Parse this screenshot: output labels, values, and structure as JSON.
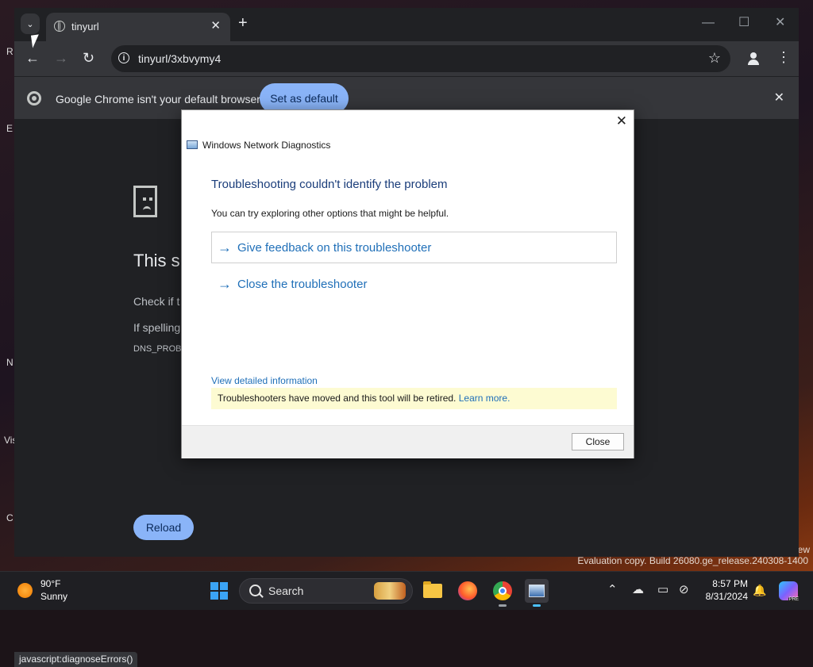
{
  "desktop": {
    "left_letters": [
      "R",
      "E",
      "N",
      "Vis",
      "C"
    ],
    "watermark": "Evaluation copy. Build 26080.ge_release.240308-1400",
    "watermark_partial": "ew"
  },
  "browser": {
    "tab": {
      "title": "tinyurl",
      "favicon": "globe-icon",
      "close_glyph": "✕"
    },
    "new_tab_glyph": "+",
    "window_controls": [
      "—",
      "☐",
      "✕"
    ],
    "nav": {
      "back": "←",
      "forward": "→",
      "reload": "↻"
    },
    "omnibox": {
      "url": "tinyurl/3xbvymy4",
      "info_glyph": "i",
      "star_glyph": "☆"
    },
    "menu_glyph": "⋮",
    "infobar": {
      "message": "Google Chrome isn't your default browser",
      "button": "Set as default",
      "close_glyph": "✕"
    },
    "error_page": {
      "title": "This si",
      "line1": "Check if t",
      "line2": "If spelling",
      "code": "DNS_PROB",
      "reload_button": "Reload"
    },
    "status_url": "javascript:diagnoseErrors()"
  },
  "dialog": {
    "close_glyph": "✕",
    "app_title": "Windows Network Diagnostics",
    "heading": "Troubleshooting couldn't identify the problem",
    "subtext": "You can try exploring other options that might be helpful.",
    "options": [
      "Give feedback on this troubleshooter",
      "Close the troubleshooter"
    ],
    "arrow_glyph": "→",
    "detail_link": "View detailed information",
    "notice_text": "Troubleshooters have moved and this tool will be retired.",
    "notice_link": "Learn more.",
    "close_button": "Close"
  },
  "taskbar": {
    "weather": {
      "temp": "90°F",
      "condition": "Sunny"
    },
    "search_label": "Search",
    "tray_glyphs": [
      "⌃",
      "☁",
      "▭",
      "⊘",
      "🔔"
    ],
    "clock": {
      "time": "8:57 PM",
      "date": "8/31/2024"
    },
    "copilot_badge": "PRE"
  }
}
